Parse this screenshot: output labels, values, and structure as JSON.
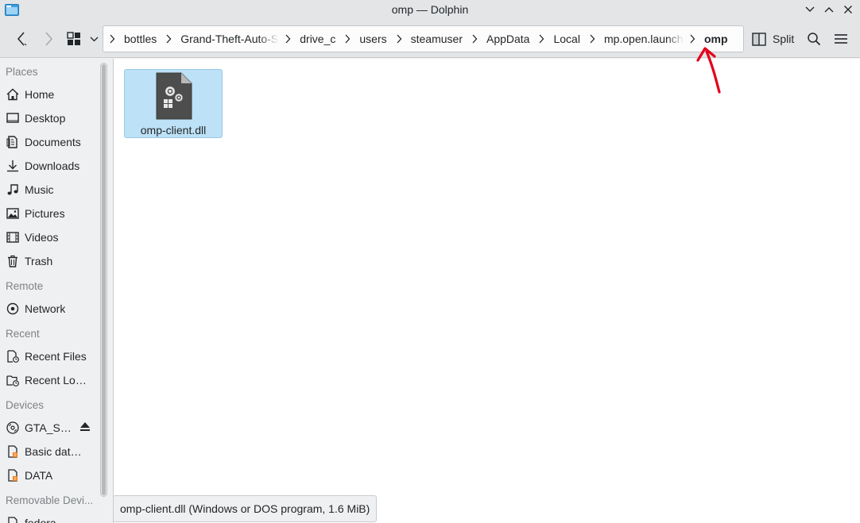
{
  "window": {
    "title": "omp — Dolphin"
  },
  "toolbar": {
    "back_icon": "chevron-left-icon",
    "forward_icon": "chevron-right-icon",
    "view_mode_icon": "icon-grid-icon",
    "split_label": "Split",
    "search_icon": "magnifier-icon",
    "menu_icon": "hamburger-menu-icon"
  },
  "breadcrumb": {
    "segments": [
      "bottles",
      "Grand-Theft-Auto-Sa",
      "drive_c",
      "users",
      "steamuser",
      "AppData",
      "Local",
      "mp.open.launch"
    ],
    "current": "omp"
  },
  "sidebar": {
    "sections": [
      {
        "title": "Places",
        "items": [
          {
            "label": "Home",
            "icon": "home-icon"
          },
          {
            "label": "Desktop",
            "icon": "desktop-icon"
          },
          {
            "label": "Documents",
            "icon": "documents-icon"
          },
          {
            "label": "Downloads",
            "icon": "downloads-icon"
          },
          {
            "label": "Music",
            "icon": "music-icon"
          },
          {
            "label": "Pictures",
            "icon": "pictures-icon"
          },
          {
            "label": "Videos",
            "icon": "videos-icon"
          },
          {
            "label": "Trash",
            "icon": "trash-icon"
          }
        ]
      },
      {
        "title": "Remote",
        "items": [
          {
            "label": "Network",
            "icon": "network-icon"
          }
        ]
      },
      {
        "title": "Recent",
        "items": [
          {
            "label": "Recent Files",
            "icon": "recent-files-icon"
          },
          {
            "label": "Recent Loc...",
            "icon": "recent-locations-icon"
          }
        ]
      },
      {
        "title": "Devices",
        "items": [
          {
            "label": "GTA_SA...",
            "icon": "optical-disc-icon",
            "eject": true
          },
          {
            "label": "Basic data ...",
            "icon": "drive-icon"
          },
          {
            "label": "DATA",
            "icon": "drive-icon"
          }
        ]
      },
      {
        "title": "Removable Devi...",
        "items": [
          {
            "label": "fedora",
            "icon": "drive-icon"
          }
        ]
      }
    ]
  },
  "files": [
    {
      "name": "omp-client.dll",
      "icon": "executable-file-icon",
      "selected": true
    }
  ],
  "status": {
    "text": "omp-client.dll (Windows or DOS program, 1.6 MiB)"
  },
  "colors": {
    "selection": "#bde1f6",
    "annotation_arrow": "#e3001b"
  }
}
